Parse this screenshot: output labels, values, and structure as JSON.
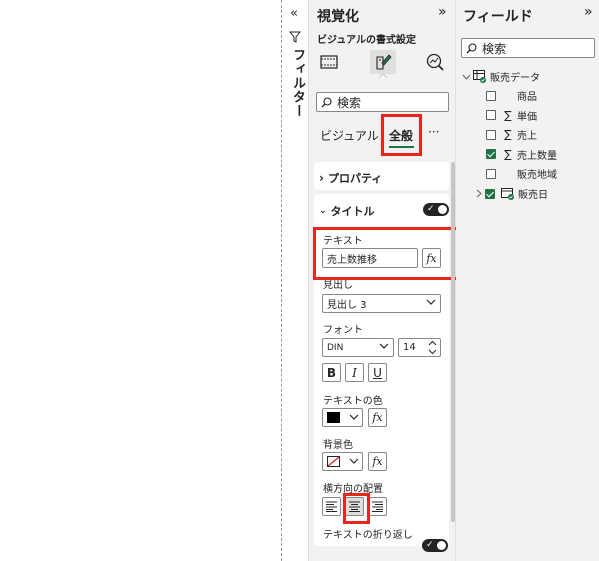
{
  "filters": {
    "label": "フィルター"
  },
  "viz_pane": {
    "title": "視覚化",
    "subtitle": "ビジュアルの書式設定",
    "search_placeholder": "検索",
    "tabs": [
      "ビジュアル",
      "全般"
    ],
    "more": "···",
    "sections": {
      "properties": "プロパティ",
      "title": "タイトル"
    },
    "text_label": "テキスト",
    "text_value": "売上数推移",
    "fx": "fx",
    "heading_label": "見出し",
    "heading_value": "見出し 3",
    "font_label": "フォント",
    "font_family": "DIN",
    "font_size": "14",
    "bold": "B",
    "italic": "I",
    "underline": "U",
    "text_color_label": "テキストの色",
    "bg_color_label": "背景色",
    "align_label": "横方向の配置",
    "wrap_label": "テキストの折り返し",
    "colors": {
      "accent_red": "#e8261d",
      "toggle_dark": "#252423",
      "field_green": "#217346"
    }
  },
  "fields_pane": {
    "title": "フィールド",
    "search_placeholder": "検索",
    "table_name": "販売データ",
    "fields": [
      {
        "name": "商品",
        "checked": false,
        "icon": ""
      },
      {
        "name": "単価",
        "checked": false,
        "icon": "sigma-icon"
      },
      {
        "name": "売上",
        "checked": false,
        "icon": "sigma-icon"
      },
      {
        "name": "売上数量",
        "checked": true,
        "icon": "sigma-icon"
      },
      {
        "name": "販売地域",
        "checked": false,
        "icon": ""
      }
    ],
    "date_field": "販売日"
  }
}
